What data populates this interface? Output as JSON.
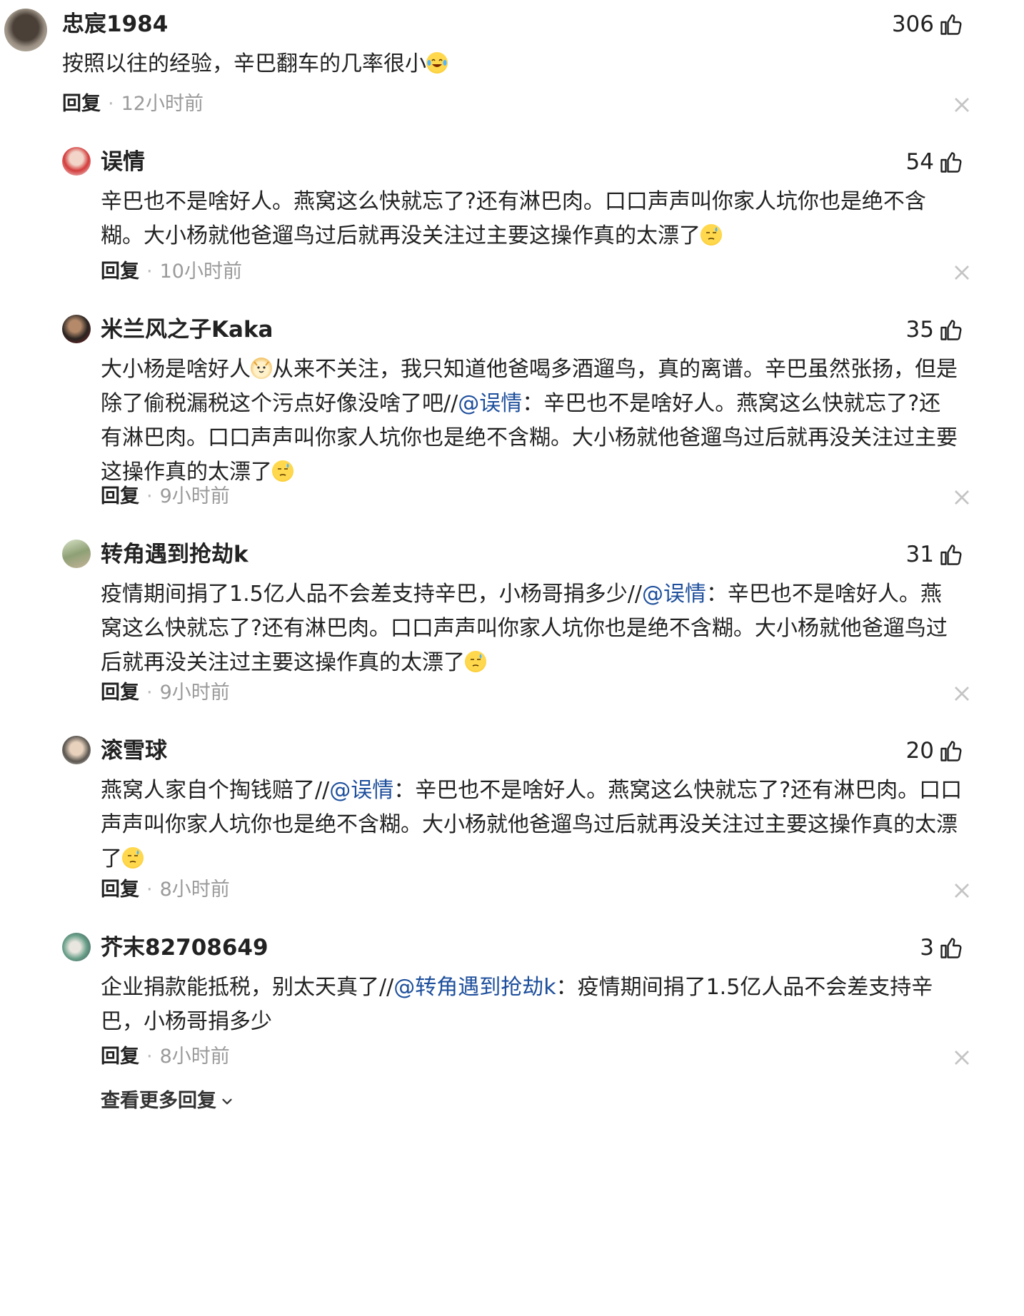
{
  "ui_text": {
    "reply_label": "回复",
    "separator": "·",
    "view_more": "查看更多回复"
  },
  "colors": {
    "mention": "#1e4f9c",
    "time": "#9a9a9a",
    "text": "#222222"
  },
  "comments": [
    {
      "user": "忠宸1984",
      "likes": "306",
      "time": "12小时前",
      "text_parts": [
        {
          "t": "按照以往的经验，辛巴翻车的几率很小"
        },
        {
          "emoji": "laugh-cry-emoji"
        }
      ]
    },
    {
      "user": "误情",
      "likes": "54",
      "time": "10小时前",
      "text_parts": [
        {
          "t": "辛巴也不是啥好人。燕窝这么快就忘了?还有淋巴肉。口口声声叫你家人坑你也是绝不含糊。大小杨就他爸遛鸟过后就再没关注过主要这操作真的太漂了"
        },
        {
          "emoji": "sweat-emoji"
        }
      ]
    },
    {
      "user": "米兰风之子Kaka",
      "likes": "35",
      "time": "9小时前",
      "text_parts": [
        {
          "t": "大小杨是啥好人"
        },
        {
          "emoji": "cat-emoji"
        },
        {
          "t": "从来不关注，我只知道他爸喝多酒遛鸟，真的离谱。辛巴虽然张扬，但是除了偷税漏税这个污点好像没啥了吧//"
        },
        {
          "mention": "@误情"
        },
        {
          "t": "：辛巴也不是啥好人。燕窝这么快就忘了?还有淋巴肉。口口声声叫你家人坑你也是绝不含糊。大小杨就他爸遛鸟过后就再没关注过主要这操作真的太漂了"
        },
        {
          "emoji": "sweat-emoji"
        }
      ]
    },
    {
      "user": "转角遇到抢劫k",
      "likes": "31",
      "time": "9小时前",
      "text_parts": [
        {
          "t": "疫情期间捐了1.5亿人品不会差支持辛巴，小杨哥捐多少//"
        },
        {
          "mention": "@误情"
        },
        {
          "t": "：辛巴也不是啥好人。燕窝这么快就忘了?还有淋巴肉。口口声声叫你家人坑你也是绝不含糊。大小杨就他爸遛鸟过后就再没关注过主要这操作真的太漂了"
        },
        {
          "emoji": "sweat-emoji"
        }
      ]
    },
    {
      "user": "滚雪球",
      "likes": "20",
      "time": "8小时前",
      "text_parts": [
        {
          "t": "燕窝人家自个掏钱赔了//"
        },
        {
          "mention": "@误情"
        },
        {
          "t": "：辛巴也不是啥好人。燕窝这么快就忘了?还有淋巴肉。口口声声叫你家人坑你也是绝不含糊。大小杨就他爸遛鸟过后就再没关注过主要这操作真的太漂了"
        },
        {
          "emoji": "sweat-emoji"
        }
      ]
    },
    {
      "user": "芥末82708649",
      "likes": "3",
      "time": "8小时前",
      "text_parts": [
        {
          "t": "企业捐款能抵税，别太天真了//"
        },
        {
          "mention": "@转角遇到抢劫k"
        },
        {
          "t": "：疫情期间捐了1.5亿人品不会差支持辛巴，小杨哥捐多少"
        }
      ]
    }
  ]
}
